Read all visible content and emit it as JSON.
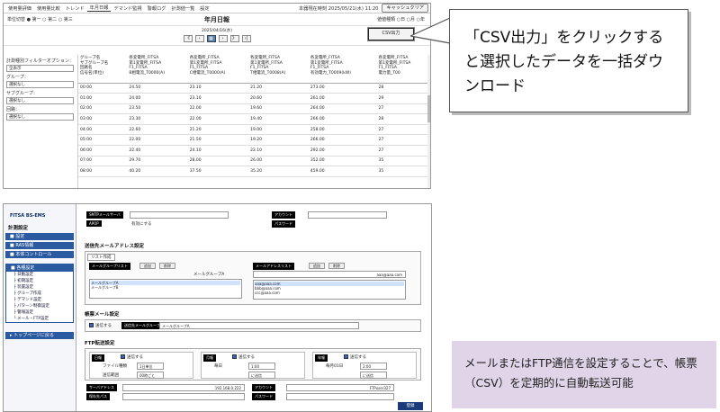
{
  "top_screen": {
    "nav_items": [
      "使用量評価",
      "使用量比較",
      "トレンド",
      "年月日報",
      "デマンド監視",
      "警報ログ",
      "計測値一覧",
      "設定"
    ],
    "active_nav_index": 3,
    "clock": "本器現在時刻 2025/05/21(水) 11:20",
    "clear_button": "キャッシュクリア",
    "unit_label": "単位切替",
    "radio_options": [
      "第一",
      "第二",
      "第三"
    ],
    "page_title": "年月日報",
    "right_options": "値値種類 ○日 ○月 ○年",
    "date_text": "2025/04/16(水)",
    "nav_buttons": [
      "《",
      "‹",
      "📅",
      "›",
      "》",
      "›|"
    ],
    "csv_button": "CSV出力",
    "filter": {
      "label_option": "計測種別フィルターオプション：",
      "option_value": "全表示",
      "label_group": "グループ：",
      "group_value": "選択なし",
      "label_subgroup": "サブグループ：",
      "subgroup_value": "選択なし",
      "label_circuit": "回路：",
      "circuit_value": "選択なし"
    },
    "col_header_label": [
      "グループ名",
      "サブグループ名",
      "回路名",
      "信号名(単位)"
    ],
    "columns": [
      [
        "各変電所_FITSA",
        "第1変電所_FITSA",
        "F1_FITSA",
        "B相電流_T0000(A)"
      ],
      [
        "各変電所_FITSA",
        "第1変電所_FITSA",
        "F1_FITSA",
        "C相電流_T0000(A)"
      ],
      [
        "各変電所_FITSA",
        "第1変電所_FITSA",
        "F1_FITSA",
        "T相電流_T0008(A)"
      ],
      [
        "各変電所_FITSA",
        "第1変電所_FITSA",
        "F1_FITSA",
        "有効電力_T0009(kW)"
      ],
      [
        "各変電所_FITSA",
        "第1変電所_FITSA",
        "F1_FITSA",
        "電力量_T00"
      ]
    ],
    "rows": [
      {
        "time": "00:00",
        "v": [
          "24.50",
          "23.10",
          "21.20",
          "273.00",
          "28"
        ]
      },
      {
        "time": "01:00",
        "v": [
          "24.00",
          "23.10",
          "20.60",
          "261.00",
          "29"
        ]
      },
      {
        "time": "02:00",
        "v": [
          "23.50",
          "22.00",
          "19.60",
          "264.00",
          "27"
        ]
      },
      {
        "time": "03:00",
        "v": [
          "23.30",
          "22.00",
          "19.40",
          "266.00",
          "28"
        ]
      },
      {
        "time": "04:00",
        "v": [
          "22.60",
          "21.20",
          "19.00",
          "258.00",
          "27"
        ]
      },
      {
        "time": "05:00",
        "v": [
          "22.00",
          "21.50",
          "19.20",
          "266.00",
          "27"
        ]
      },
      {
        "time": "06:00",
        "v": [
          "22.40",
          "24.10",
          "22.10",
          "292.00",
          "27"
        ]
      },
      {
        "time": "07:00",
        "v": [
          "29.70",
          "28.00",
          "26.00",
          "352.00",
          "35"
        ]
      },
      {
        "time": "08:00",
        "v": [
          "40.20",
          "37.50",
          "35.20",
          "459.00",
          "35"
        ]
      }
    ]
  },
  "callout_top": "「CSV出力」をクリックすると選択したデータを一括ダウンロード",
  "bottom_screen": {
    "logo": "FITSA BS-EMS",
    "section_heading": "計測設定",
    "menu_top": [
      "設定",
      "RAS情報",
      "本体コントロール"
    ],
    "menu_group_title": "各種設定",
    "menu_sub": [
      "├ 日動設定",
      "├ 初期設定",
      "├ 装置設定",
      "├ グループ作成",
      "├ デマンド設定",
      "├  パターン制御設定",
      "├ 警報設定",
      "└ メール・FTP設定"
    ],
    "back_top": "トップページに戻る",
    "smtp_label": "SMTPメールサーバ",
    "smtp_value": "",
    "auth_label": "認証",
    "auth_value": "",
    "account_label": "アカウント",
    "password_label": "パスワード",
    "apop_label": "APOP",
    "apop_value": "有効にする",
    "dest_title": "送信先メールアドレス設定",
    "list_tab": "リスト作成",
    "mailgroup_list_label": "メールグループリスト",
    "address_list_label": "メールアドレスリスト",
    "add_btn": "追加",
    "del_btn": "削除",
    "group_name_label": "メールグループA",
    "group_list": [
      "メールグループA",
      "メールグループB"
    ],
    "address_input": "aaa@aaa.com",
    "address_list": [
      "aaa@aaa.com",
      "bbb@aaa.com",
      "ccc@aaa.com"
    ],
    "report_title": "帳票メール設定",
    "send_label": "送信する",
    "report_group_label": "送信先メールグループ",
    "report_group_value": "メールグループA",
    "ftp_title": "FTP転送設定",
    "ftp_cols": [
      {
        "title": "日報",
        "enabled": "送信する",
        "l1": "ファイル種類",
        "v1": "1日単位",
        "l2": "送信範囲",
        "v2": "00時ごと"
      },
      {
        "title": "月報",
        "enabled": "送信する",
        "l1": "毎日",
        "v1": "1:00",
        "l2": "",
        "v2": "に送信"
      },
      {
        "title": "年報",
        "enabled": "送信する",
        "l1": "毎月01日",
        "v1": "2:00",
        "l2": "",
        "v2": "に送信"
      }
    ],
    "server_label": "サーバアドレス",
    "server_value": "192.168.0.222",
    "account2_label": "アカウント",
    "account2_value": "FTPuser327",
    "path_label": "保存先パス",
    "pass2_label": "パスワード",
    "save_button": "登録"
  },
  "callout_bottom": "メールまたはFTP通信を設定することで、帳票（CSV）を定期的に自動転送可能"
}
